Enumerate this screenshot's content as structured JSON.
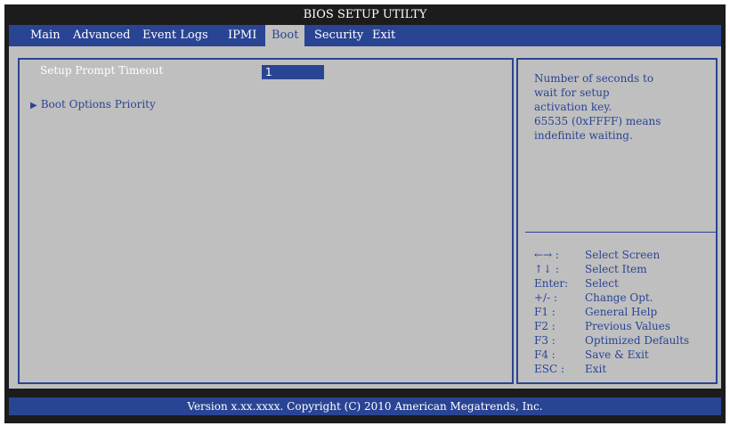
{
  "title": "BIOS SETUP UTILTY",
  "menu": [
    {
      "label": "Main"
    },
    {
      "label": "Advanced"
    },
    {
      "label": "Event Logs"
    },
    {
      "label": "IPMI"
    },
    {
      "label": "Boot"
    },
    {
      "label": "Security"
    },
    {
      "label": "Exit"
    }
  ],
  "active_tab": "Boot",
  "settings": {
    "prompt_timeout_label": "Setup Prompt Timeout",
    "prompt_timeout_value": "1",
    "boot_priority_label": "Boot Options Priority",
    "submenu_arrow": "▶"
  },
  "help": {
    "lines": [
      "Number of seconds to",
      "wait for setup",
      "activation key.",
      "65535 (0xFFFF) means",
      "indefinite waiting."
    ]
  },
  "keys": [
    {
      "key": "←→ :",
      "desc": "Select Screen"
    },
    {
      "key": "↑↓  :",
      "desc": "Select Item"
    },
    {
      "key": "Enter:",
      "desc": "Select"
    },
    {
      "key": "+/- :",
      "desc": "Change Opt."
    },
    {
      "key": "F1 :",
      "desc": "General Help"
    },
    {
      "key": "F2 :",
      "desc": "Previous Values"
    },
    {
      "key": "F3 :",
      "desc": "Optimized Defaults"
    },
    {
      "key": "F4 :",
      "desc": "Save & Exit"
    },
    {
      "key": "ESC :",
      "desc": "Exit"
    }
  ],
  "footer": "Version x.xx.xxxx. Copyright (C) 2010 American Megatrends, Inc.",
  "colors": {
    "background": "#1c1c1c",
    "accent": "#2a4494",
    "panel": "#bfbfbf"
  }
}
